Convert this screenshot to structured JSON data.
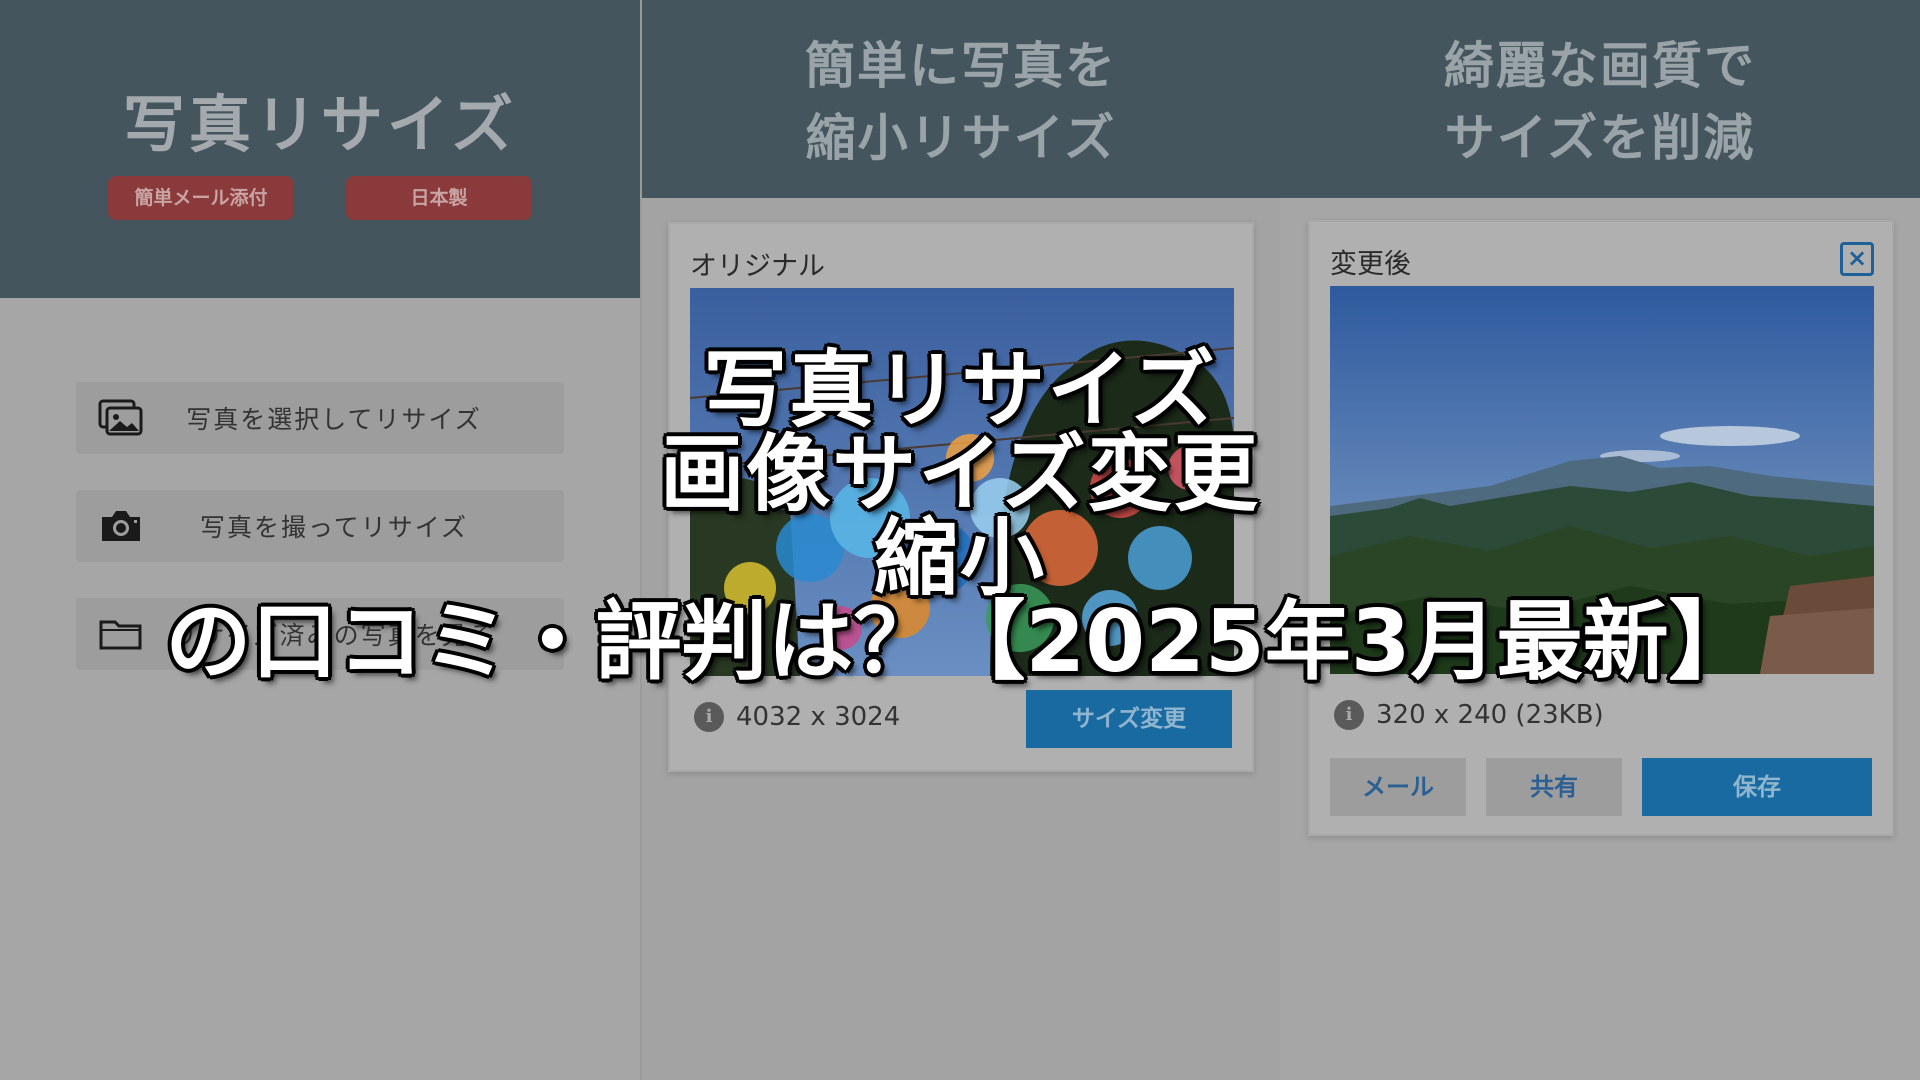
{
  "left_panel": {
    "title": "写真リサイズ",
    "badges": [
      "簡単メール添付",
      "日本製"
    ],
    "menu": [
      {
        "label": "写真を選択してリサイズ",
        "icon": "gallery-icon"
      },
      {
        "label": "写真を撮ってリサイズ",
        "icon": "camera-icon"
      },
      {
        "label": "リサイズ済みの写真を見る",
        "icon": "folder-icon"
      }
    ]
  },
  "middle_panel": {
    "tagline_lines": [
      "簡単に写真を",
      "縮小リサイズ"
    ],
    "card": {
      "title": "オリジナル",
      "dimensions": "4032 x 3024",
      "action_label": "サイズ変更",
      "photo_icon": "balloons-photo"
    }
  },
  "right_panel": {
    "tagline_lines": [
      "綺麗な画質で",
      "サイズを削減"
    ],
    "card": {
      "title": "変更後",
      "close_icon": "close-icon",
      "dimensions": "320 x 240 (23KB)",
      "photo_icon": "mountain-photo",
      "actions": [
        "メール",
        "共有",
        "保存"
      ]
    }
  },
  "overlay": {
    "title_lines": [
      "写真リサイズ",
      "画像サイズ変更",
      "縮小",
      "の口コミ・評判は？【2025年3月最新】"
    ]
  },
  "colors": {
    "header": "#44555e",
    "badge": "#8a3a3a",
    "primary": "#1a6aa2"
  }
}
